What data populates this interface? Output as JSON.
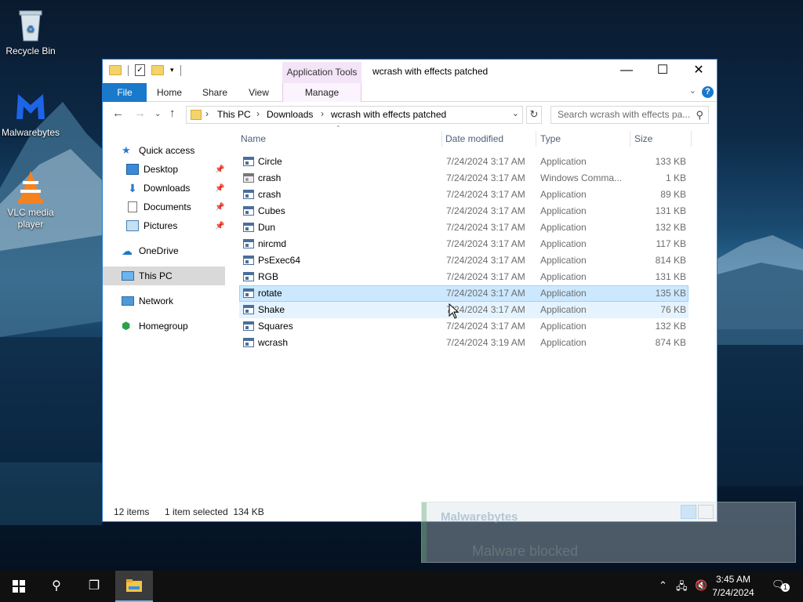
{
  "desktop": {
    "icons": [
      {
        "label": "Recycle Bin",
        "icon": "recycle-bin-icon"
      },
      {
        "label": "Malwarebytes",
        "icon": "malwarebytes-icon"
      },
      {
        "label": "VLC media player",
        "icon": "vlc-icon"
      }
    ]
  },
  "window": {
    "title": "wcrash with effects patched",
    "context_tab_group": "Application Tools",
    "tabs": [
      "File",
      "Home",
      "Share",
      "View",
      "Manage"
    ],
    "address": [
      "This PC",
      "Downloads",
      "wcrash with effects patched"
    ],
    "search_placeholder": "Search wcrash with effects pa...",
    "nav": {
      "quick_access": "Quick access",
      "quick_items": [
        "Desktop",
        "Downloads",
        "Documents",
        "Pictures"
      ],
      "onedrive": "OneDrive",
      "this_pc": "This PC",
      "network": "Network",
      "homegroup": "Homegroup"
    },
    "columns": {
      "name": "Name",
      "date": "Date modified",
      "type": "Type",
      "size": "Size"
    },
    "files": [
      {
        "name": "Circle",
        "date": "7/24/2024 3:17 AM",
        "type": "Application",
        "size": "133 KB"
      },
      {
        "name": "crash",
        "date": "7/24/2024 3:17 AM",
        "type": "Windows Comma...",
        "size": "1 KB"
      },
      {
        "name": "crash",
        "date": "7/24/2024 3:17 AM",
        "type": "Application",
        "size": "89 KB"
      },
      {
        "name": "Cubes",
        "date": "7/24/2024 3:17 AM",
        "type": "Application",
        "size": "131 KB"
      },
      {
        "name": "Dun",
        "date": "7/24/2024 3:17 AM",
        "type": "Application",
        "size": "132 KB"
      },
      {
        "name": "nircmd",
        "date": "7/24/2024 3:17 AM",
        "type": "Application",
        "size": "117 KB"
      },
      {
        "name": "PsExec64",
        "date": "7/24/2024 3:17 AM",
        "type": "Application",
        "size": "814 KB"
      },
      {
        "name": "RGB",
        "date": "7/24/2024 3:17 AM",
        "type": "Application",
        "size": "131 KB"
      },
      {
        "name": "rotate",
        "date": "7/24/2024 3:17 AM",
        "type": "Application",
        "size": "135 KB"
      },
      {
        "name": "Shake",
        "date": "7/24/2024 3:17 AM",
        "type": "Application",
        "size": "76 KB"
      },
      {
        "name": "Squares",
        "date": "7/24/2024 3:17 AM",
        "type": "Application",
        "size": "132 KB"
      },
      {
        "name": "wcrash",
        "date": "7/24/2024 3:19 AM",
        "type": "Application",
        "size": "874 KB"
      }
    ],
    "status": {
      "count": "12 items",
      "selection": "1 item selected  134 KB"
    }
  },
  "toast": {
    "brand": "Malwarebytes",
    "message": "Malware blocked"
  },
  "taskbar": {
    "time": "3:45 AM",
    "date": "7/24/2024",
    "notification_count": "1"
  },
  "colors": {
    "accent": "#1979ca",
    "selection": "#cce8ff",
    "taskbar": "#101010"
  }
}
